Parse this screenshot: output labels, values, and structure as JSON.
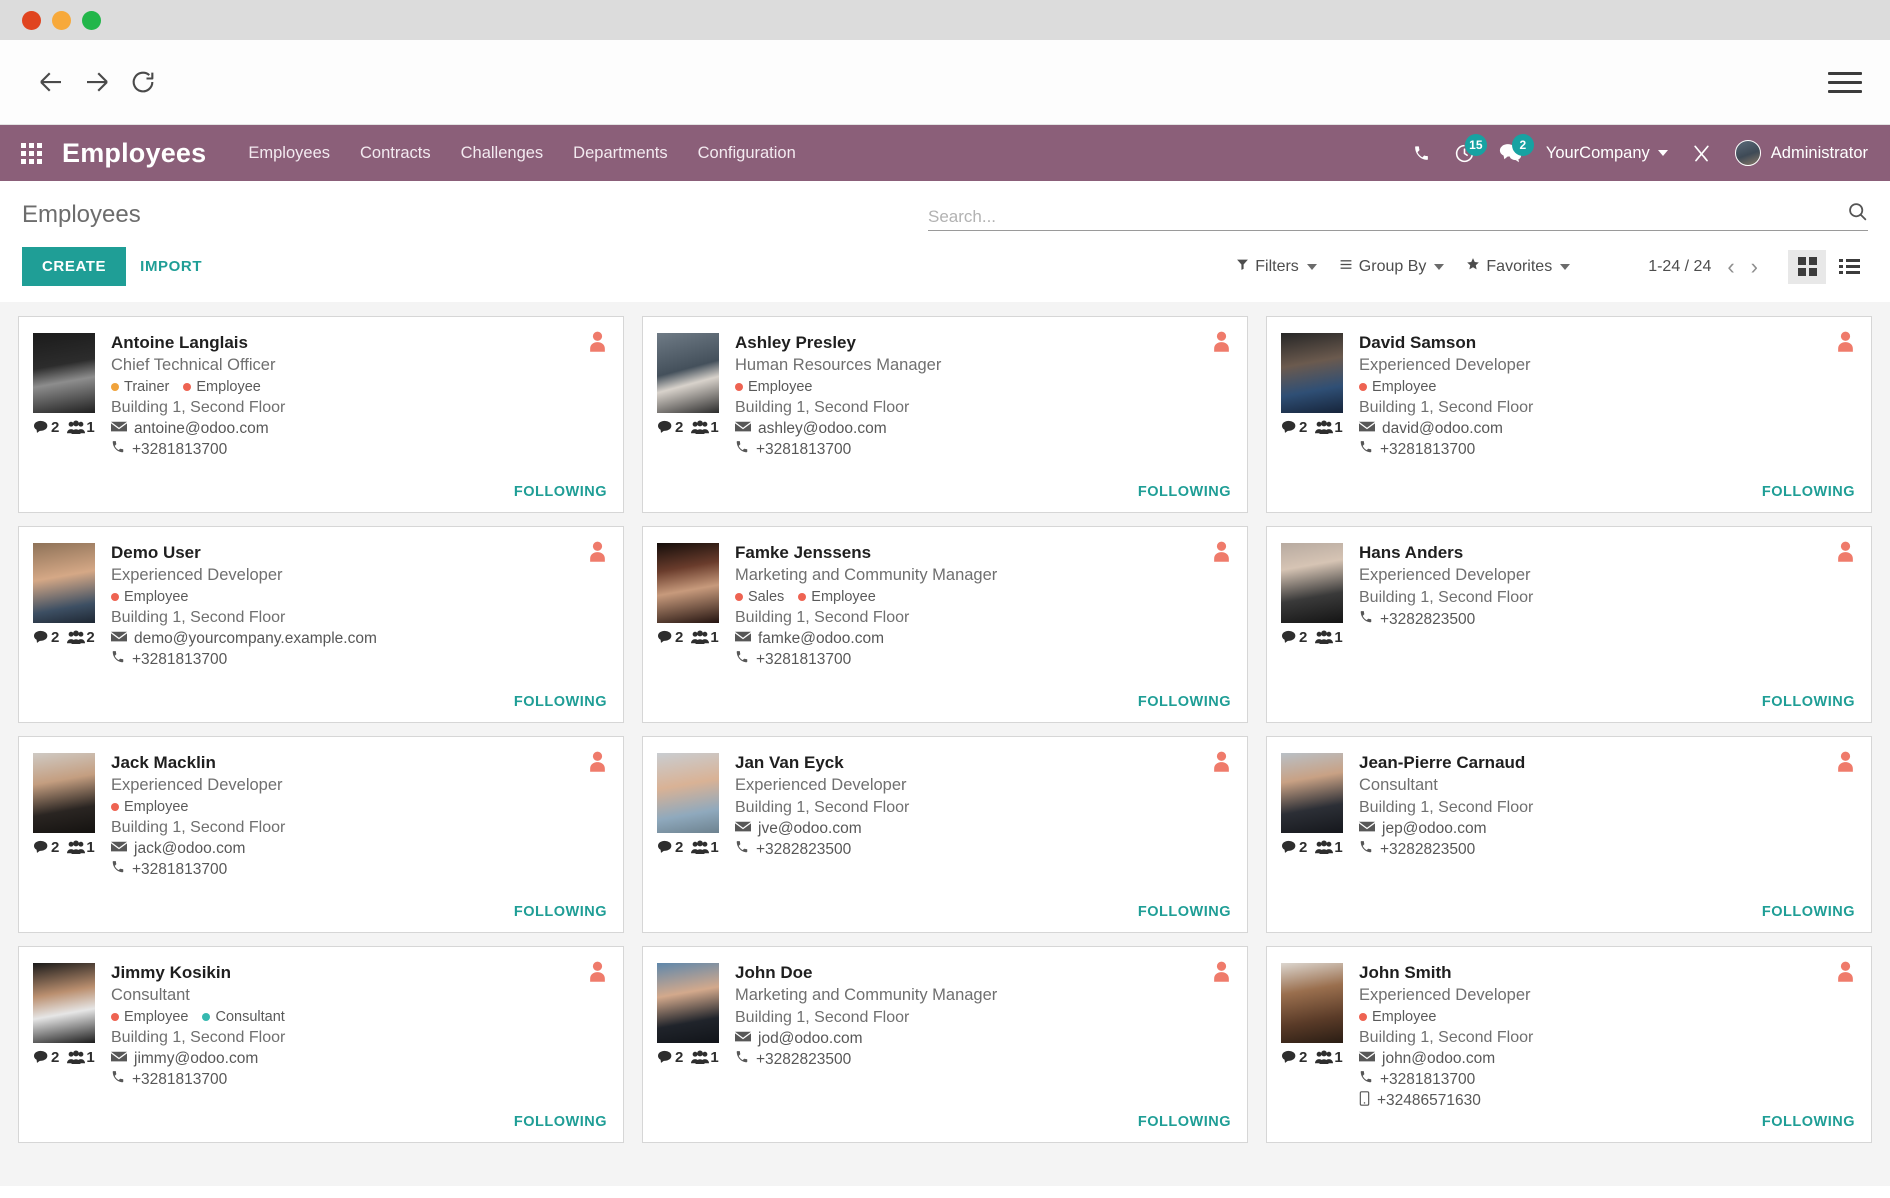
{
  "browser": {
    "back_icon": "back-arrow-icon",
    "forward_icon": "forward-arrow-icon",
    "reload_icon": "reload-icon",
    "menu_icon": "hamburger-menu-icon"
  },
  "navbar": {
    "apps_icon": "apps-grid-icon",
    "brand": "Employees",
    "menu": [
      "Employees",
      "Contracts",
      "Challenges",
      "Departments",
      "Configuration"
    ],
    "phone_icon": "phone-icon",
    "activity_icon": "clock-activity-icon",
    "activity_count": "15",
    "messages_icon": "chat-bubble-icon",
    "messages_count": "2",
    "company": "YourCompany",
    "debug_icon": "tools-wrench-icon",
    "user": "Administrator",
    "avatar_icon": "user-avatar",
    "accent_purple": "#8b5f79",
    "badge_teal": "#17a2a2"
  },
  "control_panel": {
    "title": "Employees",
    "search_placeholder": "Search...",
    "search_value": "",
    "search_icon": "search-icon",
    "create_label": "CREATE",
    "import_label": "IMPORT",
    "filters_label": "Filters",
    "filters_icon": "funnel-icon",
    "group_by_label": "Group By",
    "group_by_icon": "list-lines-icon",
    "favorites_label": "Favorites",
    "favorites_icon": "star-icon",
    "pager": "1-24 / 24",
    "prev_icon": "chevron-left-icon",
    "next_icon": "chevron-right-icon",
    "kanban_view_icon": "kanban-view-icon",
    "list_view_icon": "list-view-icon",
    "active_view": "kanban",
    "accent_teal": "#1f9e96"
  },
  "card_icons": {
    "messages_icon": "comment-icon",
    "followers_icon": "followers-group-icon",
    "email_icon": "envelope-icon",
    "phone_icon": "phone-handset-icon",
    "mobile_icon": "mobile-phone-icon",
    "user_flag_icon": "user-silhouette-icon"
  },
  "tag_colors": {
    "Trainer": "#f0a33c",
    "Employee": "#ee6352",
    "Sales": "#ee6352",
    "Consultant": "#36b9b0"
  },
  "following_label": "FOLLOWING",
  "employees": [
    {
      "name": "Antoine Langlais",
      "job": "Chief Technical Officer",
      "tags": [
        "Trainer",
        "Employee"
      ],
      "location": "Building 1, Second Floor",
      "email": "antoine@odoo.com",
      "phone": "+3281813700",
      "mobile": "",
      "messages": "2",
      "followers": "1",
      "photo": "antoine-photo"
    },
    {
      "name": "Ashley Presley",
      "job": "Human Resources Manager",
      "tags": [
        "Employee"
      ],
      "location": "Building 1, Second Floor",
      "email": "ashley@odoo.com",
      "phone": "+3281813700",
      "mobile": "",
      "messages": "2",
      "followers": "1",
      "photo": "ashley-photo"
    },
    {
      "name": "David Samson",
      "job": "Experienced Developer",
      "tags": [
        "Employee"
      ],
      "location": "Building 1, Second Floor",
      "email": "david@odoo.com",
      "phone": "+3281813700",
      "mobile": "",
      "messages": "2",
      "followers": "1",
      "photo": "david-photo"
    },
    {
      "name": "Demo User",
      "job": "Experienced Developer",
      "tags": [
        "Employee"
      ],
      "location": "Building 1, Second Floor",
      "email": "demo@yourcompany.example.com",
      "phone": "+3281813700",
      "mobile": "",
      "messages": "2",
      "followers": "2",
      "photo": "demo-photo"
    },
    {
      "name": "Famke Jenssens",
      "job": "Marketing and Community Manager",
      "tags": [
        "Sales",
        "Employee"
      ],
      "location": "Building 1, Second Floor",
      "email": "famke@odoo.com",
      "phone": "+3281813700",
      "mobile": "",
      "messages": "2",
      "followers": "1",
      "photo": "famke-photo"
    },
    {
      "name": "Hans Anders",
      "job": "Experienced Developer",
      "tags": [],
      "location": "Building 1, Second Floor",
      "email": "",
      "phone": "+3282823500",
      "mobile": "",
      "messages": "2",
      "followers": "1",
      "photo": "hans-photo"
    },
    {
      "name": "Jack Macklin",
      "job": "Experienced Developer",
      "tags": [
        "Employee"
      ],
      "location": "Building 1, Second Floor",
      "email": "jack@odoo.com",
      "phone": "+3281813700",
      "mobile": "",
      "messages": "2",
      "followers": "1",
      "photo": "jack-photo"
    },
    {
      "name": "Jan Van Eyck",
      "job": "Experienced Developer",
      "tags": [],
      "location": "Building 1, Second Floor",
      "email": "jve@odoo.com",
      "phone": "+3282823500",
      "mobile": "",
      "messages": "2",
      "followers": "1",
      "photo": "jan-photo"
    },
    {
      "name": "Jean-Pierre Carnaud",
      "job": "Consultant",
      "tags": [],
      "location": "Building 1, Second Floor",
      "email": "jep@odoo.com",
      "phone": "+3282823500",
      "mobile": "",
      "messages": "2",
      "followers": "1",
      "photo": "jeanpierre-photo"
    },
    {
      "name": "Jimmy Kosikin",
      "job": "Consultant",
      "tags": [
        "Employee",
        "Consultant"
      ],
      "location": "Building 1, Second Floor",
      "email": "jimmy@odoo.com",
      "phone": "+3281813700",
      "mobile": "",
      "messages": "2",
      "followers": "1",
      "photo": "jimmy-photo"
    },
    {
      "name": "John Doe",
      "job": "Marketing and Community Manager",
      "tags": [],
      "location": "Building 1, Second Floor",
      "email": "jod@odoo.com",
      "phone": "+3282823500",
      "mobile": "",
      "messages": "2",
      "followers": "1",
      "photo": "johndoe-photo"
    },
    {
      "name": "John Smith",
      "job": "Experienced Developer",
      "tags": [
        "Employee"
      ],
      "location": "Building 1, Second Floor",
      "email": "john@odoo.com",
      "phone": "+3281813700",
      "mobile": "+32486571630",
      "messages": "2",
      "followers": "1",
      "photo": "johnsmith-photo"
    }
  ]
}
